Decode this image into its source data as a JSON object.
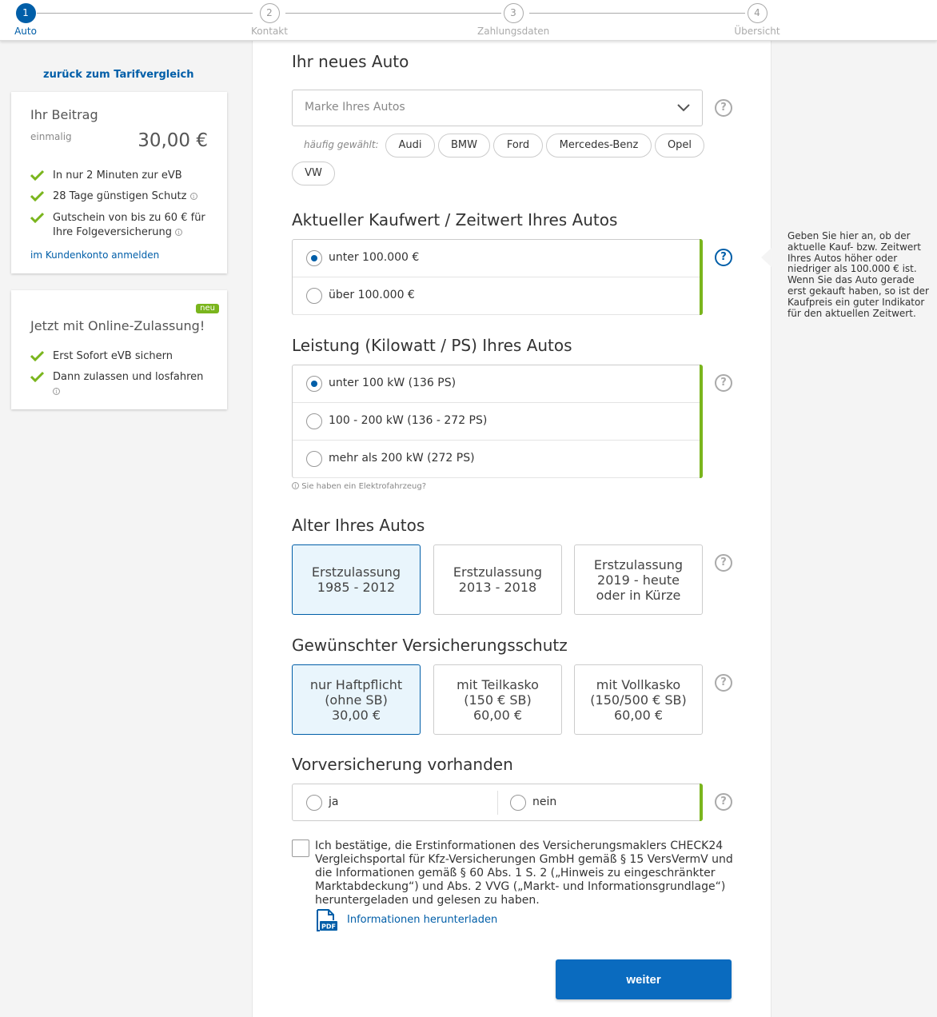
{
  "stepper": {
    "steps": [
      {
        "num": "1",
        "label": "Auto"
      },
      {
        "num": "2",
        "label": "Kontakt"
      },
      {
        "num": "3",
        "label": "Zahlungsdaten"
      },
      {
        "num": "4",
        "label": "Übersicht"
      }
    ],
    "active_step": 1
  },
  "sidebar": {
    "back_link": "zurück zum Tarifvergleich",
    "beitrag": {
      "title": "Ihr Beitrag",
      "period": "einmalig",
      "price": "30,00 €",
      "items": [
        "In nur 2 Minuten zur eVB",
        "28 Tage günstigen Schutz",
        "Gutschein von bis zu 60 € für",
        "Ihre Folgeversicherung"
      ],
      "login_link": "im Kundenkonto anmelden"
    },
    "online": {
      "badge": "neu",
      "title": "Jetzt mit Online-Zulassung!",
      "items": [
        "Erst Sofort eVB sichern",
        "Dann zulassen und losfahren"
      ]
    }
  },
  "form": {
    "neues_auto": {
      "title": "Ihr neues Auto",
      "select_placeholder": "Marke Ihres Autos",
      "frequent_label": "häufig gewählt:",
      "brands": [
        "Audi",
        "BMW",
        "Ford",
        "Mercedes-Benz",
        "Opel",
        "VW"
      ]
    },
    "kaufwert": {
      "title": "Aktueller Kaufwert / Zeitwert Ihres Autos",
      "options": [
        "unter 100.000 €",
        "über 100.000 €"
      ],
      "selected": 0
    },
    "leistung": {
      "title": "Leistung (Kilowatt / PS) Ihres Autos",
      "options": [
        "unter 100 kW (136 PS)",
        "100 - 200 kW (136 - 272 PS)",
        "mehr als 200 kW (272 PS)"
      ],
      "selected": 0,
      "elektro_hint": "Sie haben ein Elektrofahrzeug?"
    },
    "alter": {
      "title": "Alter Ihres Autos",
      "tiles": [
        {
          "line1": "Erstzulassung",
          "line2": "1985 - 2012",
          "line3": ""
        },
        {
          "line1": "Erstzulassung",
          "line2": "2013 - 2018",
          "line3": ""
        },
        {
          "line1": "Erstzulassung",
          "line2": "2019 - heute",
          "line3": "oder in Kürze"
        }
      ],
      "selected": 0
    },
    "schutz": {
      "title": "Gewünschter Versicherungsschutz",
      "tiles": [
        {
          "line1": "nur Haftpflicht",
          "line2": "(ohne SB)",
          "line3": "30,00 €"
        },
        {
          "line1": "mit Teilkasko",
          "line2": "(150 € SB)",
          "line3": "60,00 €"
        },
        {
          "line1": "mit Vollkasko",
          "line2": "(150/500 € SB)",
          "line3": "60,00 €"
        }
      ],
      "selected": 0
    },
    "vorversicherung": {
      "title": "Vorversicherung vorhanden",
      "options": [
        "ja",
        "nein"
      ]
    },
    "confirm": {
      "text": "Ich bestätige, die Erstinformationen des Versicherungsmaklers CHECK24 Vergleichsportal für Kfz-Versicherungen GmbH gemäß § 15 VersVermV und die Informationen gemäß § 60 Abs. 1 S. 2 („Hinweis zu eingeschränkter Marktabdeckung“) und Abs. 2 VVG („Markt- und Informationsgrundlage“) heruntergeladen und gelesen zu haben.",
      "pdf_link": "Informationen herunterladen",
      "pdf_icon_label": "PDF"
    },
    "submit_label": "weiter"
  },
  "tooltip": {
    "text": "Geben Sie hier an, ob der aktuelle Kauf- bzw. Zeitwert Ihres Autos höher oder niedriger als 100.000 € ist. Wenn Sie das Auto gerade erst gekauft haben, so ist der Kaufpreis ein guter Indikator für den aktuellen Zeitwert."
  },
  "colors": {
    "primary": "#005ea8",
    "accent_green": "#7ab51d",
    "selected_tile_bg": "#e9f5fc"
  }
}
